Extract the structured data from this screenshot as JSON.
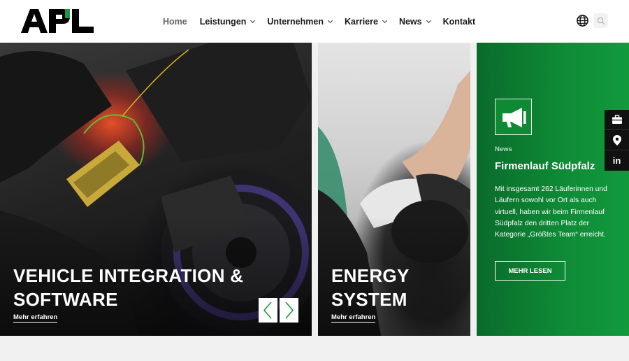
{
  "header": {
    "logo_text": "APL",
    "nav": [
      {
        "label": "Home",
        "active": true,
        "has_dropdown": false
      },
      {
        "label": "Leistungen",
        "active": false,
        "has_dropdown": true
      },
      {
        "label": "Unternehmen",
        "active": false,
        "has_dropdown": true
      },
      {
        "label": "Karriere",
        "active": false,
        "has_dropdown": true
      },
      {
        "label": "News",
        "active": false,
        "has_dropdown": true
      },
      {
        "label": "Kontakt",
        "active": false,
        "has_dropdown": false
      }
    ],
    "language_icon": "globe-icon",
    "search_icon": "search-icon"
  },
  "panels": {
    "vehicle": {
      "title_line1": "VEHICLE INTEGRATION &",
      "title_line2": "SOFTWARE",
      "link": "Mehr erfahren"
    },
    "energy": {
      "title_line1": "ENERGY",
      "title_line2": "SYSTEM",
      "link": "Mehr erfahren"
    },
    "news": {
      "icon": "megaphone-icon",
      "category": "News",
      "title": "Firmenlauf Südpfalz",
      "body": "Mit insgesamt 262 Läuferinnen und Läufern sowohl vor Ort als auch virtuell, haben wir beim Firmenlauf Südpfalz den dritten Platz der Kategorie „Größtes Team“ erreicht.",
      "button": "MEHR LESEN"
    }
  },
  "social": [
    "briefcase-icon",
    "location-pin-icon",
    "linkedin-icon"
  ],
  "social_linkedin_text": "in",
  "colors": {
    "brand_green": "#0e8a36",
    "dark": "#111111",
    "logo_green": "#1a9a3c"
  }
}
